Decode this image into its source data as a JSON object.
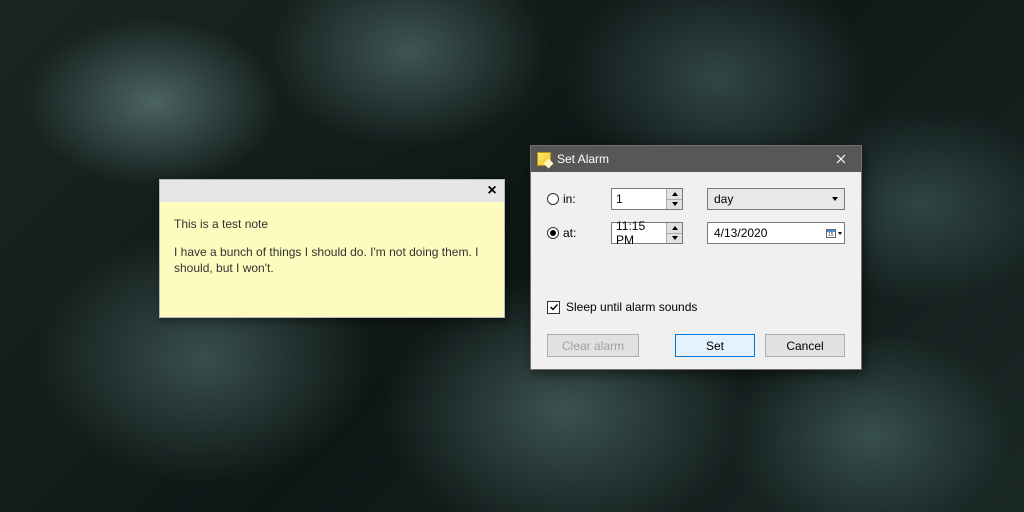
{
  "sticky_note": {
    "title": "This is a test note",
    "body": "I have a bunch of things I should do. I'm not doing them. I should, but I won't."
  },
  "alarm_dialog": {
    "title": "Set Alarm",
    "mode_in": {
      "label": "in:",
      "selected": false,
      "amount": "1",
      "unit": "day"
    },
    "mode_at": {
      "label": "at:",
      "selected": true,
      "time": "11:15 PM",
      "date": "4/13/2020"
    },
    "sleep_checkbox": {
      "label": "Sleep until alarm sounds",
      "checked": true
    },
    "buttons": {
      "clear": "Clear alarm",
      "set": "Set",
      "cancel": "Cancel"
    }
  }
}
